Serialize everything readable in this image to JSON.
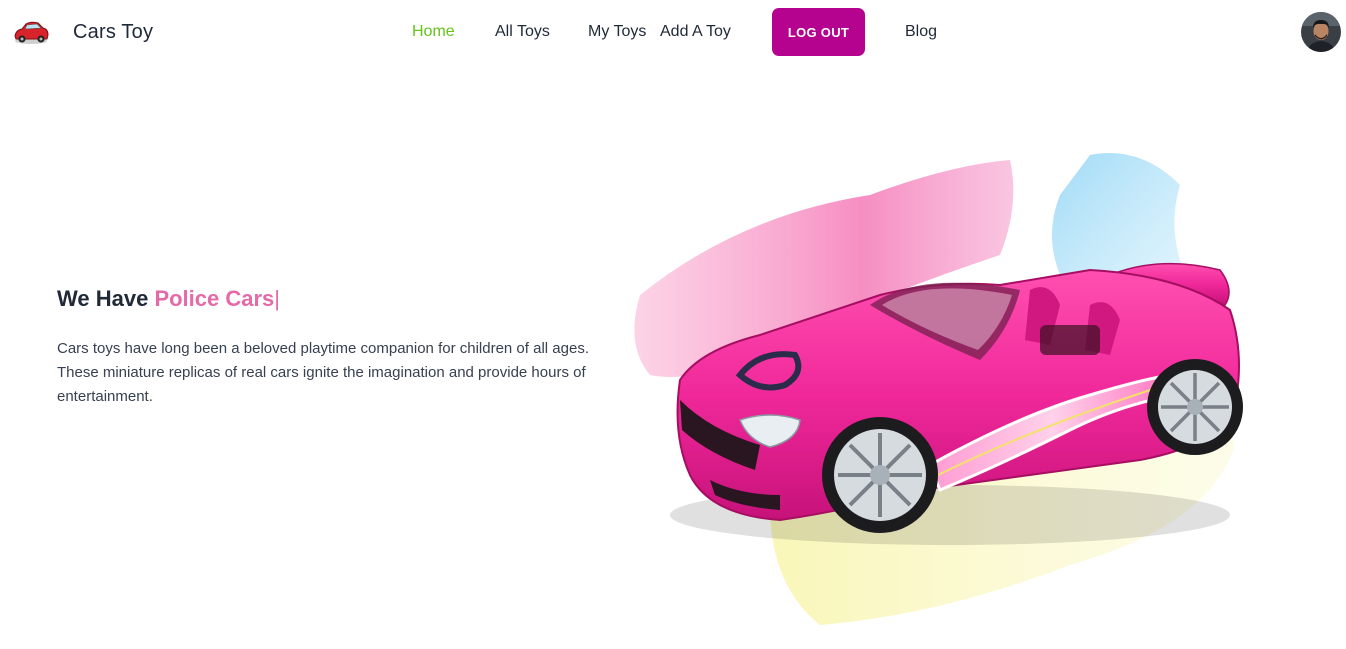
{
  "navbar": {
    "brand_name": "Cars Toy",
    "brand_logo_icon": "red-car-icon",
    "links": [
      {
        "label": "Home",
        "active": true
      },
      {
        "label": "All Toys",
        "active": false
      },
      {
        "label": "My Toys",
        "active": false
      },
      {
        "label": "Add A Toy",
        "active": false
      }
    ],
    "logout_label": "LOG OUT",
    "blog_label": "Blog",
    "avatar_icon": "user-avatar"
  },
  "hero": {
    "title_prefix": "We Have",
    "title_typed": "Police Cars",
    "cursor": "|",
    "description": "Cars toys have long been a beloved playtime companion for children of all ages. These miniature replicas of real cars ignite the imagination and provide hours of entertainment.",
    "image_icon": "pink-convertible-car-illustration"
  },
  "colors": {
    "active_link": "#65c31a",
    "logout_button": "#b5028f",
    "highlight_text": "#e46aa8",
    "car_pink": "#f0289a"
  }
}
